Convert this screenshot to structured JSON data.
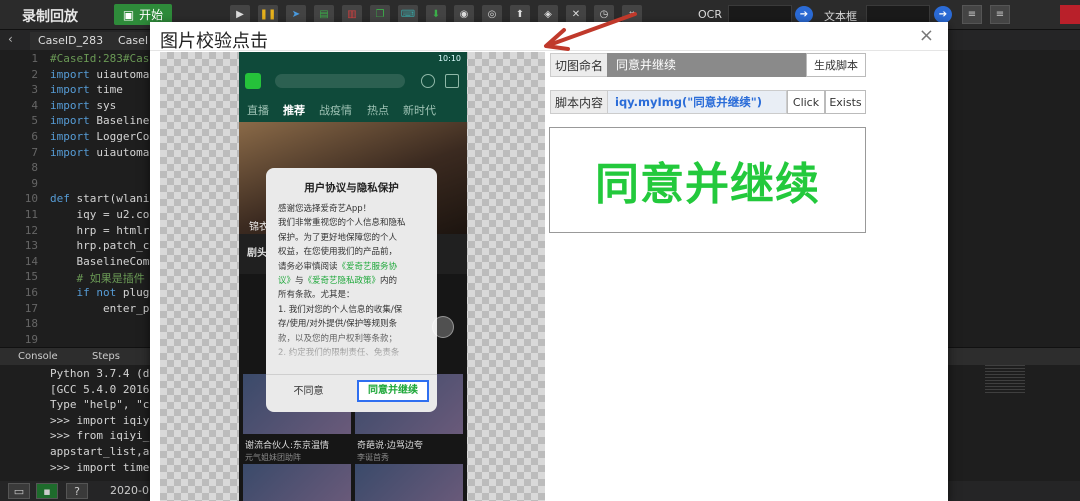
{
  "toolbar": {
    "app_title": "录制回放",
    "start_label": "开始",
    "ocr_label": "OCR",
    "textbox_label": "文本框"
  },
  "tabs": [
    {
      "label": "CaseID_283"
    },
    {
      "label": "CaseI"
    }
  ],
  "editor": {
    "lines": [
      {
        "num": "1",
        "text": "#CaseId:283#Cas",
        "kind": "comment"
      },
      {
        "num": "2",
        "text": "import uiautomat",
        "kind": "import"
      },
      {
        "num": "3",
        "text": "import time",
        "kind": "import"
      },
      {
        "num": "4",
        "text": "import sys",
        "kind": "import"
      },
      {
        "num": "5",
        "text": "import Baseline",
        "kind": "import"
      },
      {
        "num": "6",
        "text": "import LoggerCom",
        "kind": "import"
      },
      {
        "num": "7",
        "text": "import uiautomat",
        "kind": "import"
      },
      {
        "num": "8",
        "text": "",
        "kind": "plain"
      },
      {
        "num": "9",
        "text": "",
        "kind": "plain"
      },
      {
        "num": "10",
        "text": "def start(wlanip",
        "kind": "def"
      },
      {
        "num": "11",
        "text": "    iqy = u2.con",
        "kind": "plain"
      },
      {
        "num": "12",
        "text": "    hrp = htmlr",
        "kind": "plain"
      },
      {
        "num": "13",
        "text": "    hrp.patch_c",
        "kind": "plain"
      },
      {
        "num": "14",
        "text": "    BaselineComm",
        "kind": "plain"
      },
      {
        "num": "15",
        "text": "    # 如果是插件",
        "kind": "comment"
      },
      {
        "num": "16",
        "text": "    if not plugi",
        "kind": "if"
      },
      {
        "num": "17",
        "text": "        enter_pl",
        "kind": "plain"
      },
      {
        "num": "18",
        "text": "",
        "kind": "plain"
      },
      {
        "num": "19",
        "text": "",
        "kind": "plain"
      }
    ]
  },
  "console": {
    "tab_console": "Console",
    "tab_steps": "Steps",
    "lines": [
      "Python 3.7.4 (de",
      "[GCC 5.4.0 2016",
      "Type \"help\", \"co",
      ">>> import iqiy",
      ">>> from iqiyi_",
      "appstart_list,ap",
      ">>> import time"
    ]
  },
  "statusbar": {
    "date": "2020-0",
    "help": "?"
  },
  "dialog": {
    "title": "图片校验点击",
    "close": "×",
    "name_label": "切图命名",
    "name_value": "同意并继续",
    "generate_button": "生成脚本",
    "script_label": "脚本内容",
    "script_value": "iqy.myImg(\"同意并继续\")",
    "click_button": "Click",
    "exists_button": "Exists",
    "crop_preview_text": "同意并继续"
  },
  "phone": {
    "time": "10:10",
    "nav": [
      "直播",
      "推荐",
      "战疫情",
      "热点",
      "新时代"
    ],
    "banner_title": "锦衣",
    "feed_label": "剧头",
    "cards": [
      {
        "title": "谢流合伙人:东京温情",
        "sub": "元气姐妹团助阵"
      },
      {
        "title": "奇葩说·边骂边夸",
        "sub": "李诞首秀"
      }
    ],
    "popup": {
      "title": "用户协议与隐私保护",
      "body_lines": [
        {
          "text": "感谢您选择爱奇艺App！"
        },
        {
          "text": "我们非常重视您的个人信息和隐私"
        },
        {
          "text": "保护。为了更好地保障您的个人"
        },
        {
          "text": "权益，在您使用我们的产品前，"
        },
        {
          "text": "请务必审慎阅读",
          "link": "《爱奇艺服务协"
        },
        {
          "text": "",
          "link": "议》",
          "tail": "与",
          "link2": "《爱奇艺隐私政策》",
          "tail2": "内的"
        },
        {
          "text": "所有条款。尤其是："
        },
        {
          "text": "1. 我们对您的个人信息的收集/保"
        },
        {
          "text": "存/使用/对外提供/保护等规则条"
        },
        {
          "text": "款，以及您的用户权利等条款；"
        },
        {
          "text": "2. 约定我们的限制责任、免责条"
        }
      ],
      "disagree": "不同意",
      "agree": "同意并继续"
    }
  },
  "colors": {
    "accent_green": "#23c93c",
    "link_blue": "#2a6cd8",
    "annotation_red": "#c0392b"
  }
}
